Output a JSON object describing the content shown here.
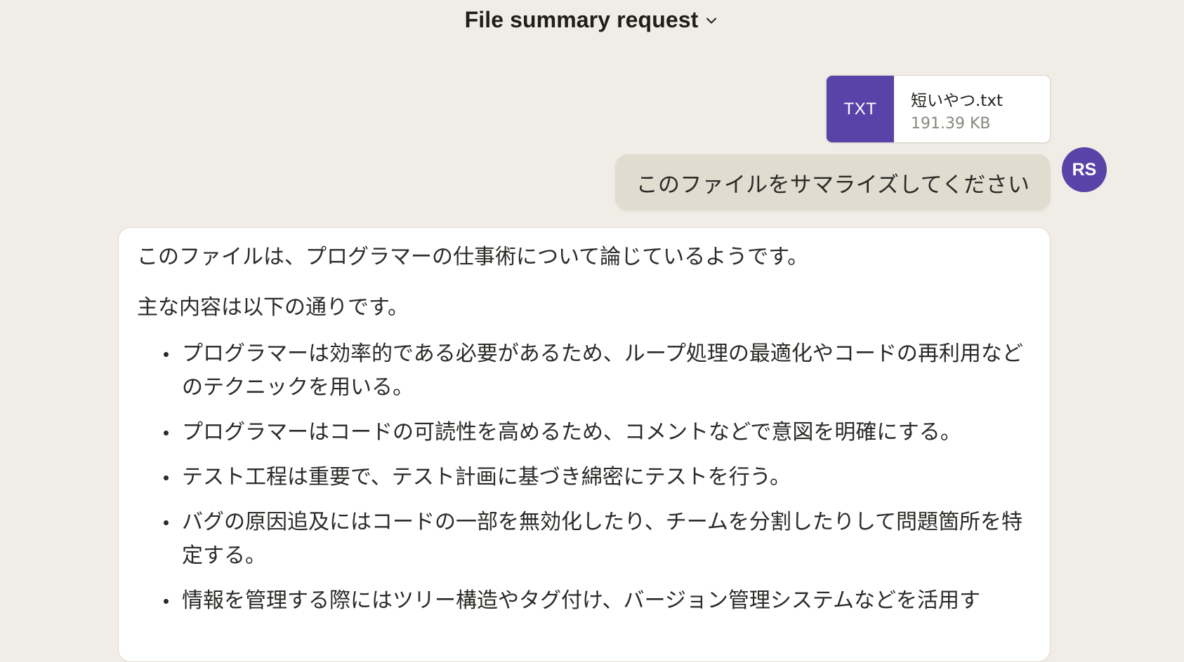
{
  "header": {
    "title": "File summary request",
    "menu_icon": "chevron-down-icon"
  },
  "attachment": {
    "type_label": "TXT",
    "file_name": "短いやつ.txt",
    "file_size": "191.39 KB",
    "badge_color": "#5a43a8"
  },
  "user": {
    "avatar_initials": "RS",
    "avatar_color": "#5a43a8",
    "message": "このファイルをサマライズしてください"
  },
  "assistant": {
    "intro": "このファイルは、プログラマーの仕事術について論じているようです。",
    "lead": "主な内容は以下の通りです。",
    "points": [
      "プログラマーは効率的である必要があるため、ループ処理の最適化やコードの再利用などのテクニックを用いる。",
      "プログラマーはコードの可読性を高めるため、コメントなどで意図を明確にする。",
      "テスト工程は重要で、テスト計画に基づき綿密にテストを行う。",
      "バグの原因追及にはコードの一部を無効化したり、チームを分割したりして問題箇所を特定する。",
      "情報を管理する際にはツリー構造やタグ付け、バージョン管理システムなどを活用す"
    ]
  }
}
